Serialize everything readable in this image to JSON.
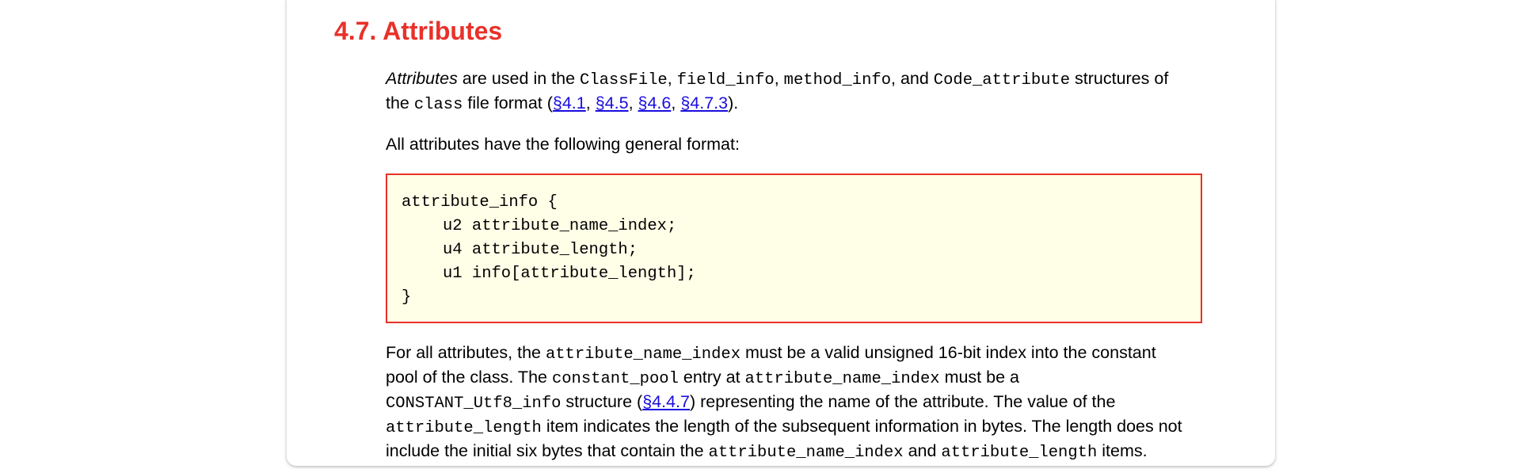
{
  "section": {
    "number": "4.7.",
    "title": "Attributes"
  },
  "intro": {
    "attributes_word": "Attributes",
    "t1": " are used in the ",
    "c1": "ClassFile",
    "t2": ", ",
    "c2": "field_info",
    "t3": ", ",
    "c3": "method_info",
    "t4": ", and ",
    "c4": "Code_attribute",
    "t5": " structures of",
    "t6": "the ",
    "c5": "class",
    "t7": " file format (",
    "links": [
      "§4.1",
      "§4.5",
      "§4.6",
      "§4.7.3"
    ],
    "sep": ", ",
    "t8": ")."
  },
  "format_intro": "All attributes have the following general format:",
  "code_block": {
    "lines": [
      "attribute_info {",
      "u2 attribute_name_index;",
      "u4 attribute_length;",
      "u1 info[attribute_length];",
      "}"
    ]
  },
  "desc": {
    "a1": "For all attributes, the ",
    "ac1": "attribute_name_index",
    "a2": " must be a valid unsigned 16-bit index into the constant",
    "b1": "pool of the class. The ",
    "bc1": "constant_pool",
    "b2": " entry at ",
    "bc2": "attribute_name_index",
    "b3": " must be a",
    "cc1": "CONSTANT_Utf8_info",
    "c1": " structure (",
    "clink": "§4.4.7",
    "c2": ") representing the name of the attribute. The value of the",
    "dc1": "attribute_length",
    "d1": " item indicates the length of the subsequent information in bytes. The length does not",
    "e1": "include the initial six bytes that contain the ",
    "ec1": "attribute_name_index",
    "e2": " and ",
    "ec2": "attribute_length",
    "e3": " items."
  },
  "colors": {
    "heading": "#e8312a",
    "link": "#1a0dde",
    "code_bg": "#fffee7",
    "code_border": "#e8312a"
  }
}
